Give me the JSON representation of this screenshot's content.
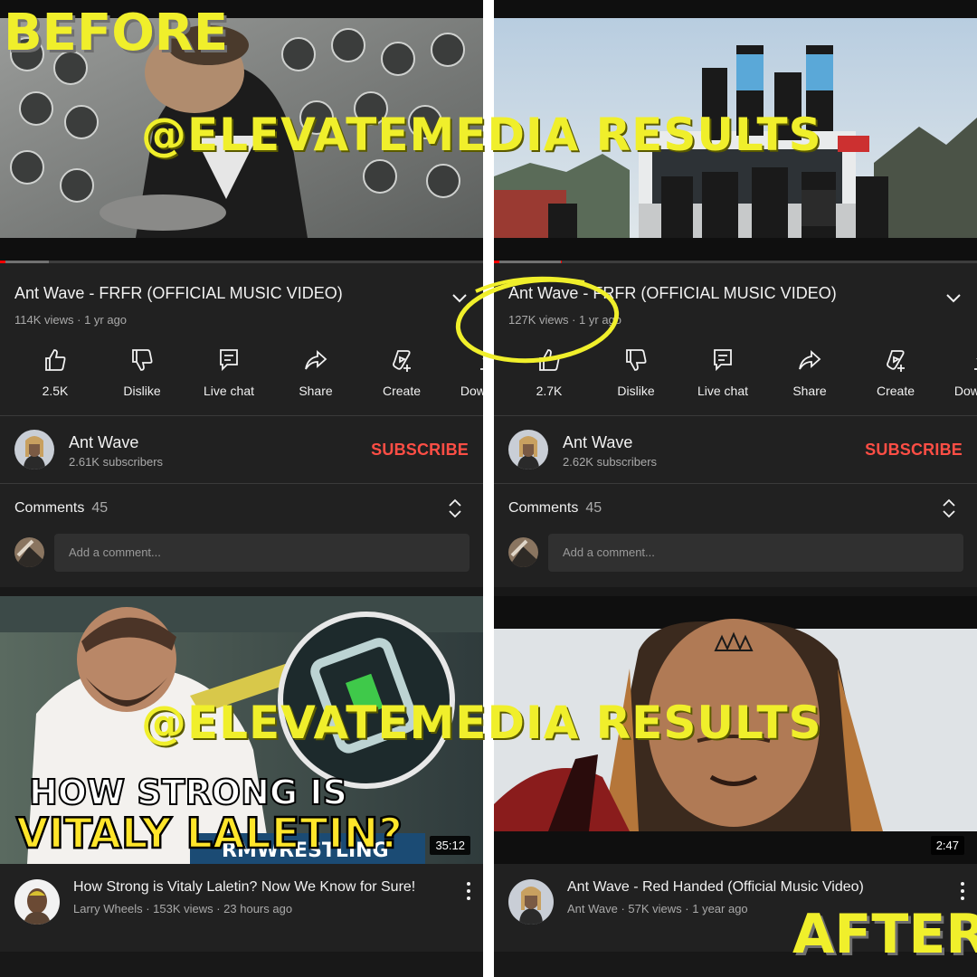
{
  "overlay": {
    "before_label": "BEFORE",
    "after_label": "AFTER",
    "watermark_top": "@ELEVATEMEDIA RESULTS",
    "watermark_bottom": "@ELEVATEMEDIA RESULTS",
    "highlight_color": "#f0ef2b"
  },
  "colors": {
    "background": "#212121",
    "subscribe": "#ff4e45",
    "progress": "#ff0000",
    "secondary_text": "#aaaaaa"
  },
  "before": {
    "video_title": "Ant Wave - FRFR (OFFICIAL MUSIC VIDEO)",
    "video_meta": "114K views · 1 yr ago",
    "progress": 0.1,
    "actions": {
      "like": "2.5K",
      "dislike": "Dislike",
      "live_chat": "Live chat",
      "share": "Share",
      "create": "Create",
      "download": "Download"
    },
    "channel": {
      "name": "Ant Wave",
      "subscribers": "2.61K subscribers",
      "subscribe_label": "SUBSCRIBE"
    },
    "comments": {
      "label": "Comments",
      "count": "45",
      "placeholder": "Add a comment..."
    },
    "next_video": {
      "thumbnail_line1": "HOW STRONG IS",
      "thumbnail_line2": "VITALY LALETIN?",
      "duration": "35:12",
      "title": "How Strong is Vitaly Laletin? Now We Know for Sure!",
      "meta": "Larry Wheels · 153K views · 23 hours ago"
    }
  },
  "after": {
    "video_title": "Ant Wave - FRFR (OFFICIAL MUSIC VIDEO)",
    "video_meta": "127K views · 1 yr ago",
    "progress": 0.14,
    "actions": {
      "like": "2.7K",
      "dislike": "Dislike",
      "live_chat": "Live chat",
      "share": "Share",
      "create": "Create",
      "download": "Download"
    },
    "channel": {
      "name": "Ant Wave",
      "subscribers": "2.62K subscribers",
      "subscribe_label": "SUBSCRIBE"
    },
    "comments": {
      "label": "Comments",
      "count": "45",
      "placeholder": "Add a comment..."
    },
    "next_video": {
      "duration": "2:47",
      "title": "Ant Wave - Red Handed (Official Music Video)",
      "meta": "Ant Wave · 57K views · 1 year ago"
    }
  }
}
